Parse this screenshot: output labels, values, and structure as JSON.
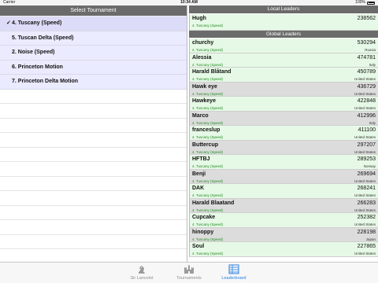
{
  "status_bar": {
    "carrier": "Carrier",
    "time": "10:34 AM",
    "battery": "100%"
  },
  "left_panel": {
    "header": "Select Tournament",
    "tournaments": [
      {
        "label": "4. Tuscany (Speed)",
        "selected": true,
        "check": "✓"
      },
      {
        "label": "5. Tuscan Delta (Speed)",
        "selected": false,
        "check": ""
      },
      {
        "label": "2. Noise (Speed)",
        "selected": false,
        "check": ""
      },
      {
        "label": "6. Princeton Motion",
        "selected": false,
        "check": ""
      },
      {
        "label": "7. Princeton Delta Motion",
        "selected": false,
        "check": ""
      }
    ]
  },
  "local_leaders": {
    "header": "Local Leaders",
    "rows": [
      {
        "name": "Hugh",
        "score": "238562",
        "track": "4. Tuscany (Speed)",
        "country": ""
      }
    ]
  },
  "global_leaders": {
    "header": "Global Leaders",
    "rows": [
      {
        "name": "churchy",
        "score": "530294",
        "track": "4. Tuscany (Speed)",
        "country": "Russia",
        "shade": "g"
      },
      {
        "name": "Alessia",
        "score": "474781",
        "track": "4. Tuscany (Speed)",
        "country": "Italy",
        "shade": "g"
      },
      {
        "name": "Harald Blåtand",
        "score": "450789",
        "track": "4. Tuscany (Speed)",
        "country": "United States",
        "shade": "g"
      },
      {
        "name": "Hawk eye",
        "score": "436729",
        "track": "4. Tuscany (Speed)",
        "country": "United States",
        "shade": "s"
      },
      {
        "name": "Hawkeye",
        "score": "422848",
        "track": "4. Tuscany (Speed)",
        "country": "United States",
        "shade": "g"
      },
      {
        "name": "Marco",
        "score": "412996",
        "track": "4. Tuscany (Speed)",
        "country": "Italy",
        "shade": "s"
      },
      {
        "name": "franceslup",
        "score": "411100",
        "track": "4. Tuscany (Speed)",
        "country": "United States",
        "shade": "g"
      },
      {
        "name": "Buttercup",
        "score": "297207",
        "track": "4. Tuscany (Speed)",
        "country": "United States",
        "shade": "s"
      },
      {
        "name": "HFTBJ",
        "score": "289253",
        "track": "4. Tuscany (Speed)",
        "country": "Norway",
        "shade": "g"
      },
      {
        "name": "Benji",
        "score": "269694",
        "track": "4. Tuscany (Speed)",
        "country": "United States",
        "shade": "s"
      },
      {
        "name": "DAK",
        "score": "268241",
        "track": "4. Tuscany (Speed)",
        "country": "United States",
        "shade": "g"
      },
      {
        "name": "Harald Blaatand",
        "score": "266283",
        "track": "4. Tuscany (Speed)",
        "country": "United States",
        "shade": "s"
      },
      {
        "name": "Cupcake",
        "score": "252382",
        "track": "4. Tuscany (Speed)",
        "country": "United States",
        "shade": "g"
      },
      {
        "name": "hinoppy",
        "score": "228198",
        "track": "4. Tuscany (Speed)",
        "country": "Japan",
        "shade": "s"
      },
      {
        "name": "Soul",
        "score": "227865",
        "track": "4. Tuscany (Speed)",
        "country": "United States",
        "shade": "g"
      }
    ]
  },
  "tab_bar": {
    "tabs": [
      {
        "label": "Sir Lancelot",
        "icon": "knight-icon",
        "active": false
      },
      {
        "label": "Tournaments",
        "icon": "castle-icon",
        "active": false
      },
      {
        "label": "Leaderboard",
        "icon": "leaderboard-icon",
        "active": true
      }
    ]
  },
  "colors": {
    "accent": "#2c7fe0",
    "header": "#6b6b6b",
    "row_green": "#e6f9e6",
    "row_gray": "#dcdcdc",
    "row_lavender": "#ebebff",
    "track_text": "#228b22"
  }
}
